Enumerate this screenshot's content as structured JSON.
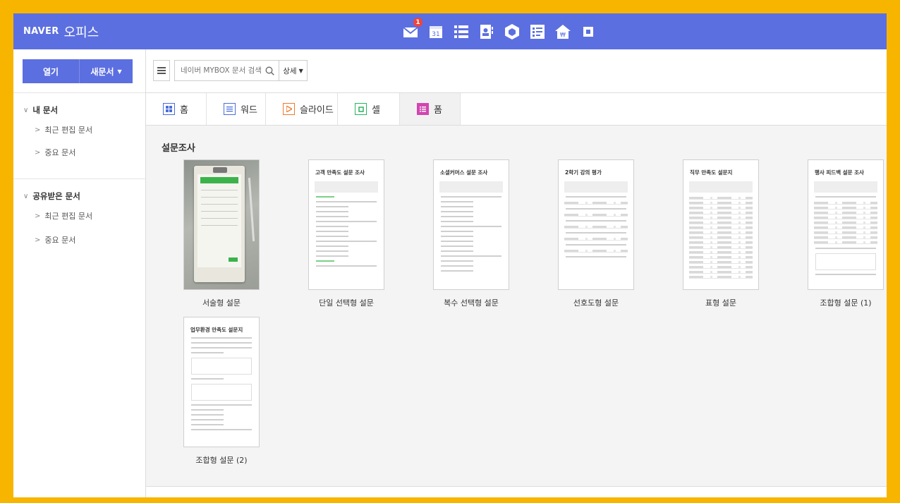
{
  "header": {
    "brand": "NAVER",
    "product": "오피스",
    "mail_badge": "1",
    "calendar_day": "31",
    "app_icons": [
      "mail-icon",
      "calendar-icon",
      "list-icon",
      "contacts-icon",
      "cube-icon",
      "form-icon",
      "house-icon",
      "square-icon"
    ]
  },
  "sidebar": {
    "open_label": "열기",
    "new_label": "새문서",
    "my_docs": {
      "label": "내 문서",
      "items": [
        "최근 편집 문서",
        "중요 문서"
      ]
    },
    "shared_docs": {
      "label": "공유받은 문서",
      "items": [
        "최근 편집 문서",
        "중요 문서"
      ]
    }
  },
  "toolbar": {
    "search_placeholder": "네이버 MYBOX 문서 검색",
    "detail_label": "상세"
  },
  "tabs": [
    {
      "label": "홈",
      "icon": "home-icon",
      "color": "#4a6ed8"
    },
    {
      "label": "워드",
      "icon": "word-icon",
      "color": "#4a6ed8"
    },
    {
      "label": "슬라이드",
      "icon": "slide-icon",
      "color": "#f07a2a"
    },
    {
      "label": "셀",
      "icon": "cell-icon",
      "color": "#2bb35f"
    },
    {
      "label": "폼",
      "icon": "form-icon",
      "color": "#d246b0"
    }
  ],
  "content": {
    "section_title": "설문조사",
    "templates": [
      {
        "label": "서술형 설문",
        "preview_title": ""
      },
      {
        "label": "단일 선택형 설문",
        "preview_title": "고객 만족도 설문 조사"
      },
      {
        "label": "복수 선택형 설문",
        "preview_title": "소셜커머스 설문 조사"
      },
      {
        "label": "선호도형 설문",
        "preview_title": "2학기 강의 평가"
      },
      {
        "label": "표형 설문",
        "preview_title": "직무 만족도 설문지"
      },
      {
        "label": "조합형 설문 (1)",
        "preview_title": "행사 피드백 설문 조사"
      },
      {
        "label": "조합형 설문 (2)",
        "preview_title": "업무환경 만족도 설문지"
      }
    ]
  }
}
